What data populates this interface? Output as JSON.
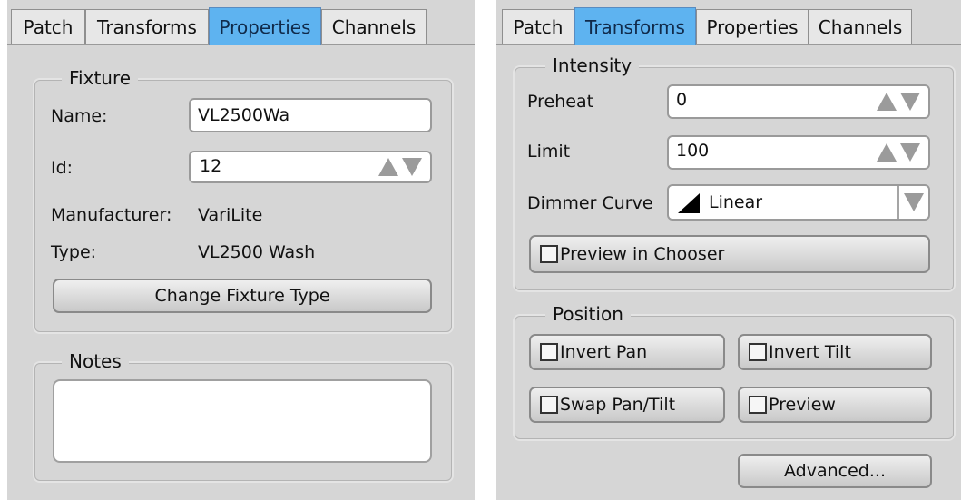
{
  "left_panel": {
    "tabs": [
      {
        "label": "Patch"
      },
      {
        "label": "Transforms"
      },
      {
        "label": "Properties"
      },
      {
        "label": "Channels"
      }
    ],
    "active_tab": "Properties",
    "fixture_group": {
      "title": "Fixture",
      "name_label": "Name:",
      "name_value": "VL2500Wa",
      "id_label": "Id:",
      "id_value": "12",
      "manufacturer_label": "Manufacturer:",
      "manufacturer_value": "VariLite",
      "type_label": "Type:",
      "type_value": "VL2500 Wash",
      "change_button": "Change Fixture Type"
    },
    "notes_group": {
      "title": "Notes",
      "value": ""
    }
  },
  "right_panel": {
    "tabs": [
      {
        "label": "Patch"
      },
      {
        "label": "Transforms"
      },
      {
        "label": "Properties"
      },
      {
        "label": "Channels"
      }
    ],
    "active_tab": "Transforms",
    "intensity_group": {
      "title": "Intensity",
      "preheat_label": "Preheat",
      "preheat_value": "0",
      "limit_label": "Limit",
      "limit_value": "100",
      "dimmer_curve_label": "Dimmer Curve",
      "dimmer_curve_value": "Linear",
      "preview_in_chooser": {
        "label": "Preview in Chooser",
        "checked": false
      }
    },
    "position_group": {
      "title": "Position",
      "invert_pan": {
        "label": "Invert Pan",
        "checked": false
      },
      "invert_tilt": {
        "label": "Invert Tilt",
        "checked": false
      },
      "swap_pan_tilt": {
        "label": "Swap Pan/Tilt",
        "checked": false
      },
      "preview": {
        "label": "Preview",
        "checked": false
      }
    },
    "advanced_button": "Advanced..."
  },
  "colors": {
    "panel_bg": "#d6d6d6",
    "active_tab": "#5eb3f0",
    "inactive_tab": "#e7e7e7",
    "spinner_arrow": "#9b9b9b"
  },
  "icons": [
    "spinner-up-arrow-icon",
    "spinner-down-arrow-icon",
    "dropdown-arrow-icon",
    "linear-curve-icon",
    "checkbox-icon"
  ]
}
